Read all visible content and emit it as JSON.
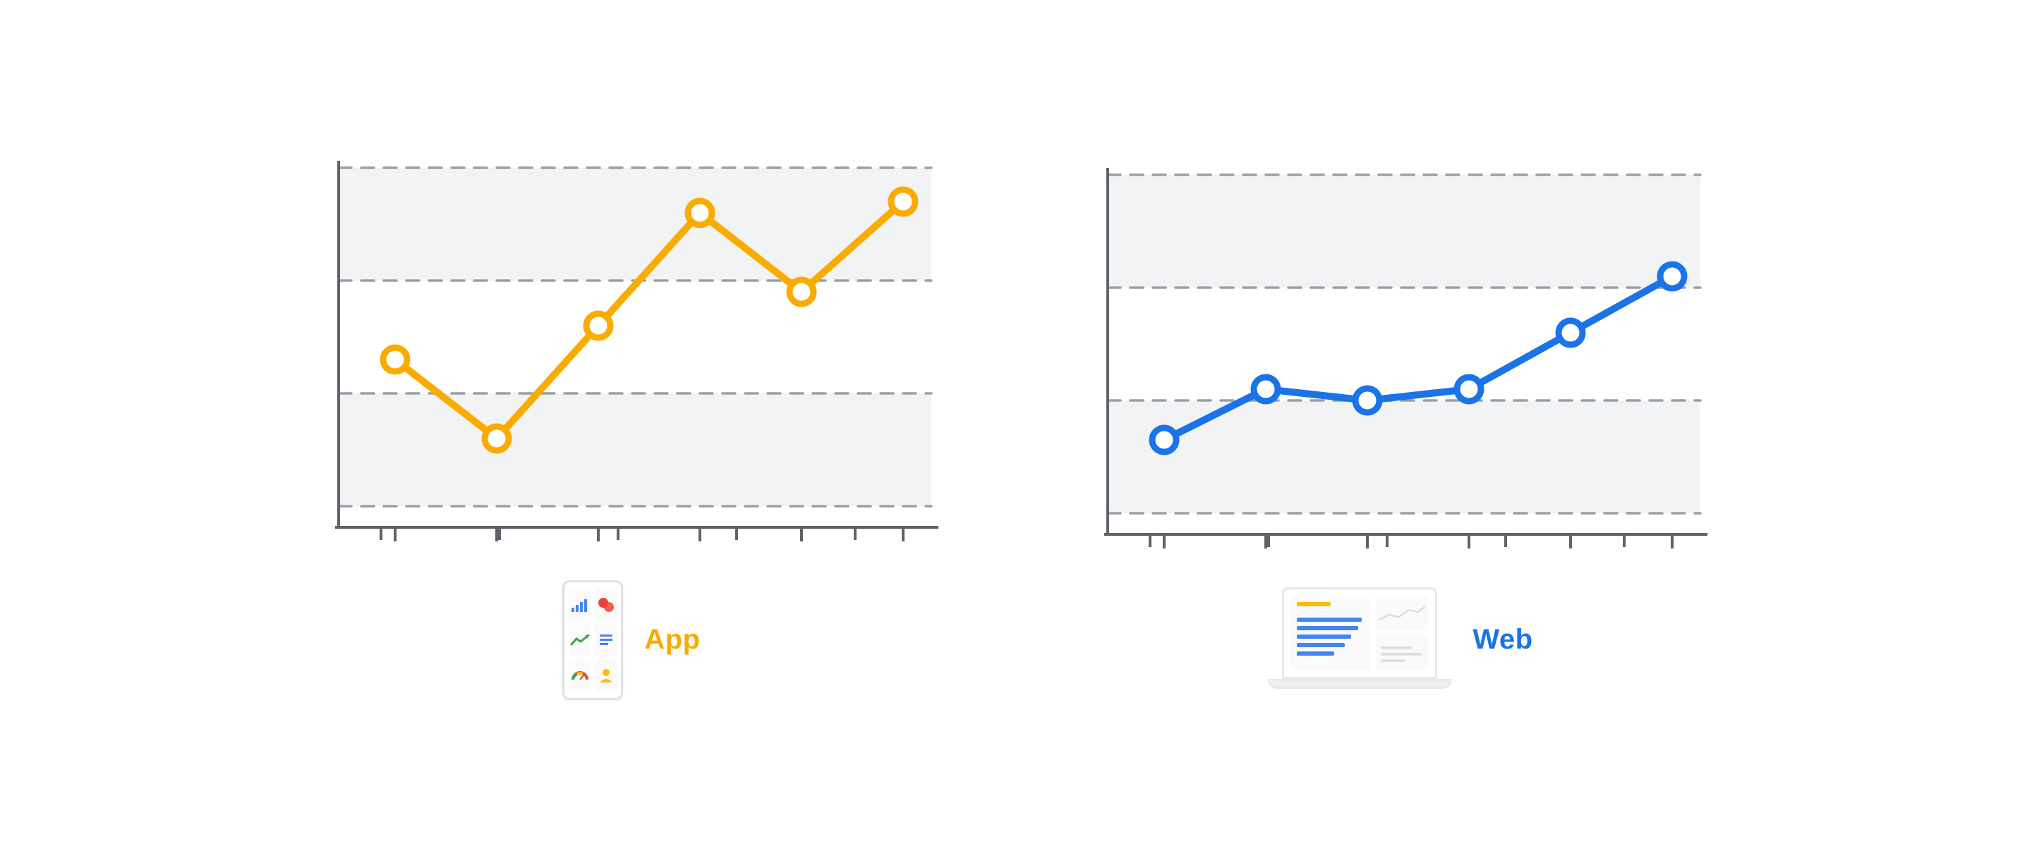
{
  "chart_data": [
    {
      "type": "line",
      "name": "App",
      "color": "#F9AB00",
      "x": [
        0,
        1,
        2,
        3,
        4,
        5
      ],
      "values": [
        1.3,
        0.6,
        1.6,
        2.6,
        1.9,
        2.7
      ],
      "ylim": [
        0,
        3
      ],
      "xlim": [
        0,
        5
      ],
      "gridlines_y": [
        0,
        1,
        2,
        3
      ],
      "xlabel": "",
      "ylabel": "",
      "title": "",
      "legend_position": "bottom"
    },
    {
      "type": "line",
      "name": "Web",
      "color": "#1A73E8",
      "x": [
        0,
        1,
        2,
        3,
        4,
        5
      ],
      "values": [
        0.65,
        1.1,
        1.0,
        1.1,
        1.6,
        2.1
      ],
      "ylim": [
        0,
        3
      ],
      "xlim": [
        0,
        5
      ],
      "gridlines_y": [
        0,
        1,
        2,
        3
      ],
      "xlabel": "",
      "ylabel": "",
      "title": "",
      "legend_position": "bottom"
    }
  ],
  "legends": {
    "app": "App",
    "web": "Web"
  },
  "colors": {
    "app": "#F9AB00",
    "web": "#1A73E8",
    "axis": "#5F6368",
    "grid": "#9AA0A6",
    "band": "#F1F3F4",
    "google_blue": "#4285F4",
    "google_red": "#EA4335",
    "google_yellow": "#FBBC04",
    "google_green": "#34A853"
  }
}
